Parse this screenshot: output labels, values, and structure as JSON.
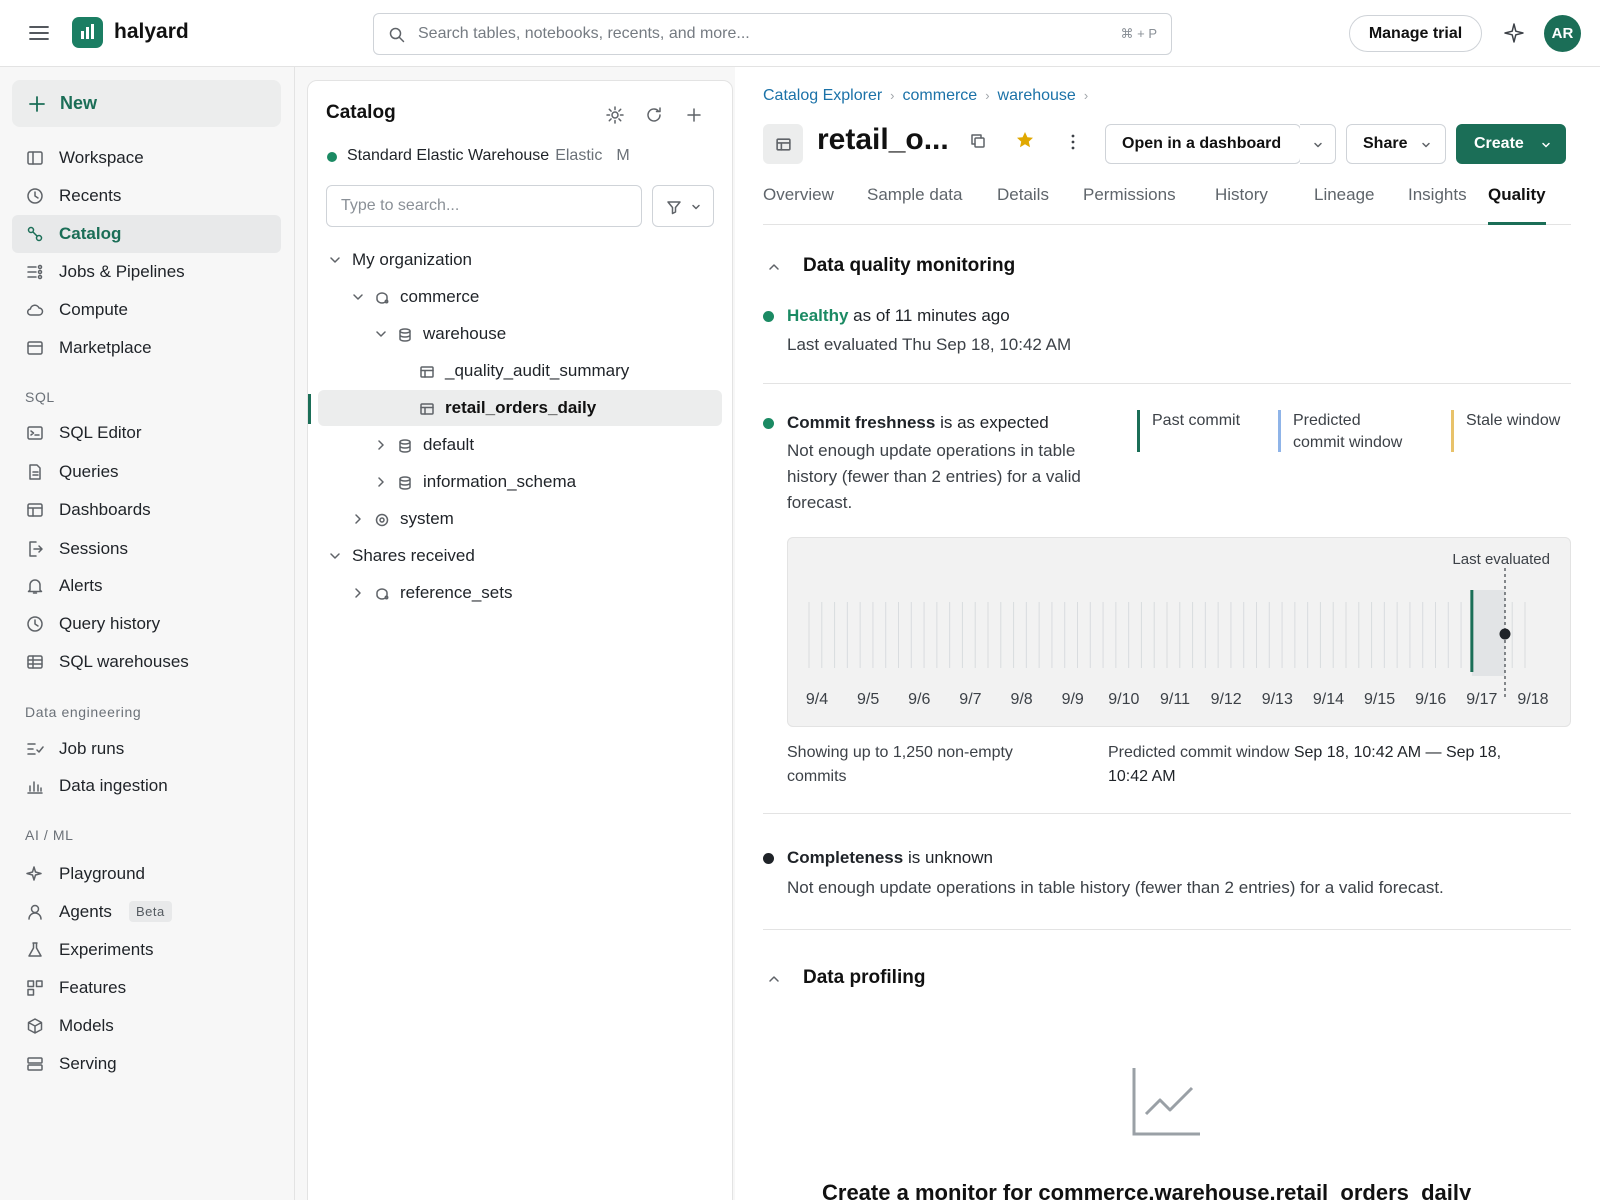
{
  "topbar": {
    "brand": "halyard",
    "search_placeholder": "Search tables, notebooks, recents, and more...",
    "search_shortcut": "⌘ + P",
    "manage_trial": "Manage trial",
    "avatar_initials": "AR"
  },
  "sidebar": {
    "new_label": "New",
    "items": [
      {
        "label": "Workspace",
        "icon": "workspace-icon"
      },
      {
        "label": "Recents",
        "icon": "clock-icon"
      },
      {
        "label": "Catalog",
        "icon": "catalog-icon",
        "active": true
      },
      {
        "label": "Jobs & Pipelines",
        "icon": "jobs-icon"
      },
      {
        "label": "Compute",
        "icon": "cloud-icon"
      },
      {
        "label": "Marketplace",
        "icon": "marketplace-icon"
      }
    ],
    "sql_header": "SQL",
    "sql_items": [
      {
        "label": "SQL Editor"
      },
      {
        "label": "Queries"
      },
      {
        "label": "Dashboards"
      },
      {
        "label": "Sessions"
      },
      {
        "label": "Alerts"
      },
      {
        "label": "Query history"
      },
      {
        "label": "SQL warehouses"
      }
    ],
    "de_header": "Data engineering",
    "de_items": [
      {
        "label": "Job runs"
      },
      {
        "label": "Data ingestion"
      }
    ],
    "ai_header": "AI / ML",
    "ai_items": [
      {
        "label": "Playground"
      },
      {
        "label": "Agents",
        "badge": "Beta"
      },
      {
        "label": "Experiments"
      },
      {
        "label": "Features"
      },
      {
        "label": "Models"
      },
      {
        "label": "Serving"
      }
    ]
  },
  "catalog": {
    "title": "Catalog",
    "warehouse_name": "Standard Elastic Warehouse",
    "warehouse_type": "Elastic",
    "warehouse_size": "M",
    "search_placeholder": "Type to search...",
    "tree": {
      "my_org": "My organization",
      "commerce": "commerce",
      "warehouse": "warehouse",
      "quality_audit": "_quality_audit_summary",
      "retail_orders": "retail_orders_daily",
      "default": "default",
      "information_schema": "information_schema",
      "system": "system",
      "shares_received": "Shares received",
      "reference_sets": "reference_sets"
    }
  },
  "main": {
    "breadcrumbs": [
      "Catalog Explorer",
      "commerce",
      "warehouse"
    ],
    "title": "retail_o...",
    "open_dashboard": "Open in a dashboard",
    "share": "Share",
    "create": "Create",
    "tabs": [
      "Overview",
      "Sample data",
      "Details",
      "Permissions",
      "History",
      "Lineage",
      "Insights",
      "Quality"
    ],
    "active_tab": "Quality",
    "dq": {
      "header": "Data quality monitoring",
      "healthy": "Healthy",
      "healthy_rest": "as of 11 minutes ago",
      "last_evaluated": "Last evaluated Thu Sep 18, 10:42 AM",
      "freshness_bold": "Commit freshness",
      "freshness_rest": "is as expected",
      "freshness_desc_1": "Not enough update operations in table",
      "freshness_desc_2": "history (fewer than 2 entries) for a valid",
      "freshness_desc_3": "forecast.",
      "legend_past": "Past commit",
      "legend_predicted_1": "Predicted",
      "legend_predicted_2": "commit window",
      "legend_stale": "Stale window",
      "chart_last_evaluated": "Last evaluated",
      "showing_1": "Showing up to 1,250 non-empty",
      "showing_2": "commits",
      "predicted_label": "Predicted commit window",
      "predicted_value_1": "Sep 18, 10:42 AM — Sep 18,",
      "predicted_value_2": "10:42 AM",
      "completeness_bold": "Completeness",
      "completeness_rest": "is unknown",
      "completeness_desc": "Not enough update operations in table history (fewer than 2 entries) for a valid forecast."
    },
    "profiling": {
      "header": "Data profiling",
      "cta": "Create a monitor for commerce.warehouse.retail_orders_daily"
    }
  },
  "colors": {
    "accent": "#1b6e57",
    "healthy": "#1b8a63",
    "past_commit": "#1b6e57",
    "predicted": "#8fb4e8",
    "stale": "#e8c26a",
    "link": "#1b72a8"
  },
  "chart_data": {
    "type": "timeline",
    "x_ticks": [
      "9/4",
      "9/5",
      "9/6",
      "9/7",
      "9/8",
      "9/9",
      "9/10",
      "9/11",
      "9/12",
      "9/13",
      "9/14",
      "9/15",
      "9/16",
      "9/17",
      "9/18"
    ],
    "past_commits": [
      "9/17"
    ],
    "last_evaluated": "9/18",
    "annotation": "Last evaluated"
  }
}
